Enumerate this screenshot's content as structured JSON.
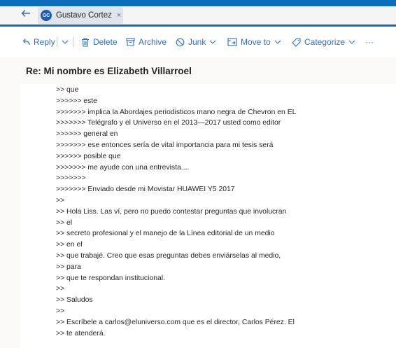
{
  "header": {
    "sender_initials": "GC",
    "sender_name": "Gustavo Cortez",
    "close_symbol": "×"
  },
  "toolbar": {
    "reply": "Reply",
    "delete": "Delete",
    "archive": "Archive",
    "junk": "Junk",
    "move_to": "Move to",
    "categorize": "Categorize",
    "more": "···"
  },
  "message": {
    "subject": "Re: Mi nombre es Elizabeth Villarroel",
    "lines": [
      ">> que",
      ">>>>>> este",
      ">>>>>>> implica la Abordajes periodisticos mano negra de Chevron en EL",
      ">>>>>>> Telégrafo y el Universo en el 2013—2017 usted como editor",
      ">>>>>> general en",
      ">>>>>>> ese entonces sería de vital importancia para mi tesis será",
      ">>>>>> posible que",
      ">>>>>>> me ayude con una entrevista....",
      ">>>>>>>",
      ">>>>>>> Enviado desde mi Movistar HUAWEI Y5 2017",
      ">>",
      ">> Hola Liss. Las ví, pero no puedo contestar preguntas que involucran",
      ">> el",
      ">> secreto profesional y el manejo de la Línea editorial de un medio",
      ">> en el",
      ">> que trabajé. Creo que esas preguntas debes enviárselas al medio,",
      ">> para",
      ">> que te respondan institucional.",
      ">>",
      ">> Saludos",
      ">>",
      ">> Escríbele a carlos@eluniverso.com que es el director, Carlos Pérez. El",
      ">> te atenderá."
    ]
  },
  "colors": {
    "accent": "#0f6cbd",
    "toolbar_text": "#2e6fc4",
    "avatar": "#1f5cae"
  },
  "icons": [
    "back-arrow-icon",
    "close-icon",
    "reply-icon",
    "chevron-down-icon",
    "delete-icon",
    "archive-icon",
    "junk-icon",
    "move-to-icon",
    "categorize-icon",
    "more-icon"
  ]
}
